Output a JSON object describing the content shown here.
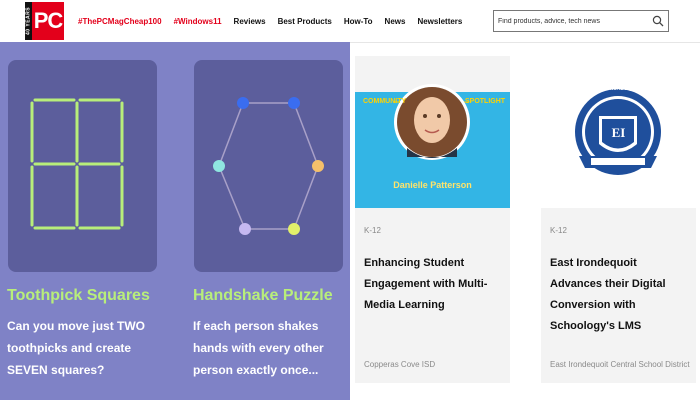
{
  "header": {
    "logo_side": "40 YEARS",
    "logo_text": "PC",
    "nav": [
      {
        "label": "#ThePCMagCheap100",
        "accent": true
      },
      {
        "label": "#Windows11",
        "accent": true
      },
      {
        "label": "Reviews",
        "accent": false
      },
      {
        "label": "Best Products",
        "accent": false
      },
      {
        "label": "How-To",
        "accent": false
      },
      {
        "label": "News",
        "accent": false
      },
      {
        "label": "Newsletters",
        "accent": false
      }
    ],
    "search_placeholder": "Find products, advice, tech news"
  },
  "puzzles": [
    {
      "title": "Toothpick Squares",
      "lines": [
        "Can you move just TWO",
        "toothpicks and create",
        "SEVEN squares?"
      ]
    },
    {
      "title": "Handshake Puzzle",
      "lines": [
        "If each person shakes",
        "hands with every other",
        "person exactly once..."
      ]
    }
  ],
  "cards": [
    {
      "banner_left": "COMMUNITY",
      "banner_right": "SPOTLIGHT",
      "person_name": "Danielle Patterson",
      "tag": "K-12",
      "title": "Enhancing Student Engagement with Multi-Media Learning",
      "source": "Copperas Cove ISD"
    },
    {
      "seal_text": "EAST IRONDEQUOIT",
      "seal_initials": "EI",
      "tag": "K-12",
      "title": "East Irondequoit Advances their Digital Conversion with Schoology's LMS",
      "source": "East Irondequoit Central School District"
    }
  ],
  "colors": {
    "brand_red": "#e3001b",
    "puzzle_bg": "#7f82c6",
    "puzzle_card": "#5c5e9c",
    "puzzle_title": "#b8ee7a",
    "spotlight_blue": "#33b5e5",
    "seal_blue": "#1f4f9c"
  }
}
